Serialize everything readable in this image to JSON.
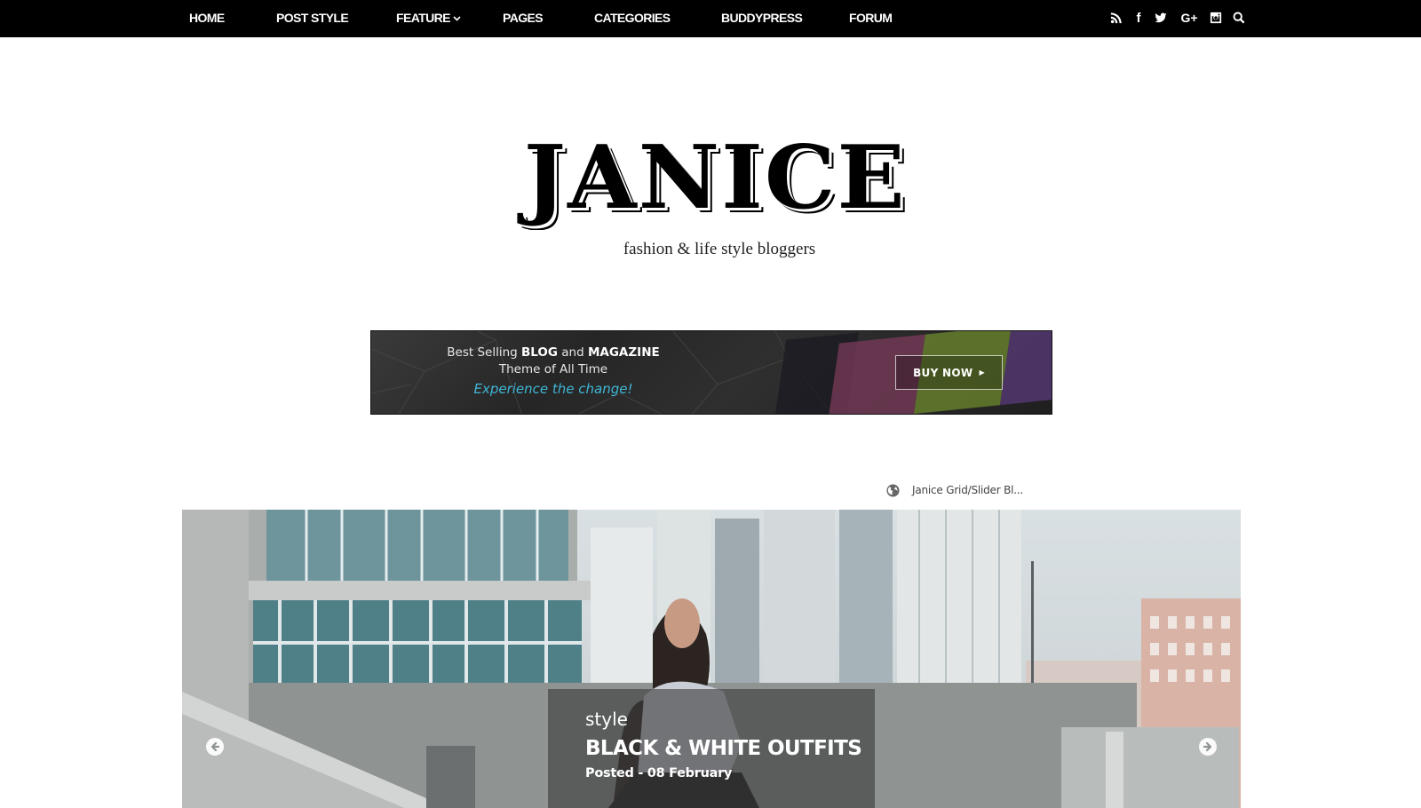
{
  "nav": {
    "items": [
      {
        "label": "HOME"
      },
      {
        "label": "POST STYLE"
      },
      {
        "label": "FEATURE",
        "has_dropdown": true
      },
      {
        "label": "PAGES"
      },
      {
        "label": "CATEGORIES"
      },
      {
        "label": "BUDDYPRESS"
      },
      {
        "label": "FORUM"
      }
    ],
    "dropdown_icon": "chevron-down-icon",
    "social_icons": [
      "rss-icon",
      "facebook-icon",
      "twitter-icon",
      "google-plus-icon",
      "instagram-icon",
      "search-icon"
    ],
    "facebook_glyph": "f",
    "google_glyph": "G+"
  },
  "header": {
    "logo_text": "JANICE",
    "tagline": "fashion & life style bloggers"
  },
  "banner": {
    "line1_pre": "Best Selling ",
    "line1_b1": "BLOG",
    "line1_mid": " and ",
    "line1_b2": "MAGAZINE",
    "line2": "Theme of All Time",
    "line3": "Experience the change!",
    "cta_label": "BUY NOW",
    "cta_icon": "caret-right-icon",
    "accent_color": "#3fb6d6"
  },
  "crumb": {
    "icon": "globe-icon",
    "text": "Janice Grid/Slider Bl..."
  },
  "slider": {
    "category": "style",
    "title": "BLACK & WHITE OUTFITS",
    "date": "Posted - 08 February",
    "prev_icon": "arrow-left-circle-icon",
    "next_icon": "arrow-right-circle-icon"
  }
}
